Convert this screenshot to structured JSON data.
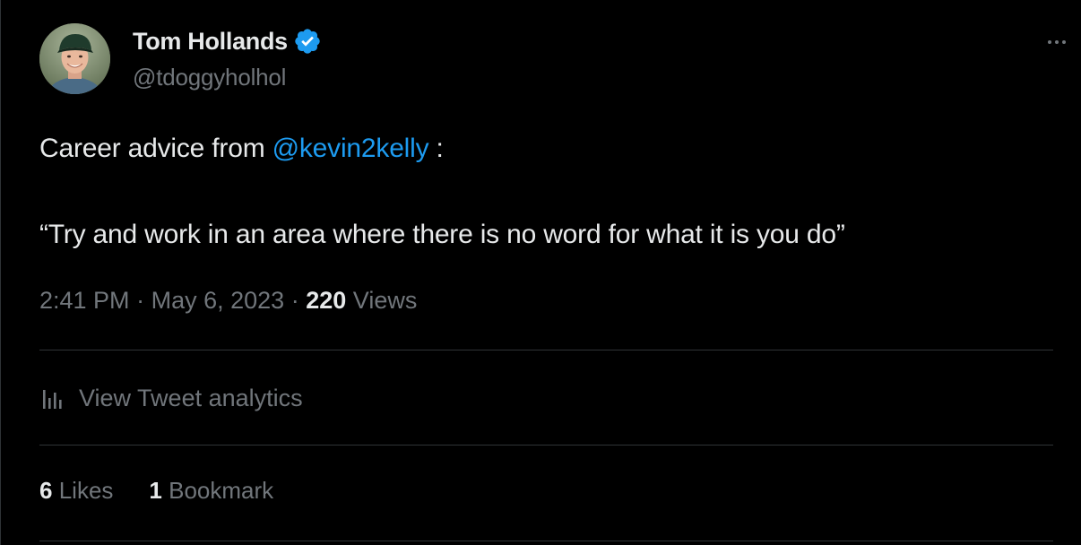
{
  "tweet": {
    "author": {
      "display_name": "Tom Hollands",
      "handle": "@tdoggyholhol",
      "verified": true
    },
    "text": {
      "prefix": "Career advice from ",
      "mention": "@kevin2kelly",
      "suffix": " :",
      "quote": "“Try and work in an area where there is no word for what it is you do”"
    },
    "meta": {
      "time": "2:41 PM",
      "separator": "·",
      "date": "May 6, 2023",
      "views_count": "220",
      "views_label": "Views"
    },
    "analytics_label": "View Tweet analytics",
    "stats": {
      "likes_count": "6",
      "likes_label": "Likes",
      "bookmarks_count": "1",
      "bookmarks_label": "Bookmark"
    }
  },
  "icons": {
    "verified": "verified-badge-icon",
    "more": "more-options-icon",
    "analytics": "analytics-bars-icon"
  },
  "colors": {
    "background": "#000000",
    "text": "#e7e9ea",
    "secondary_text": "#71767b",
    "accent": "#1d9bf0",
    "divider": "#2f3336"
  }
}
